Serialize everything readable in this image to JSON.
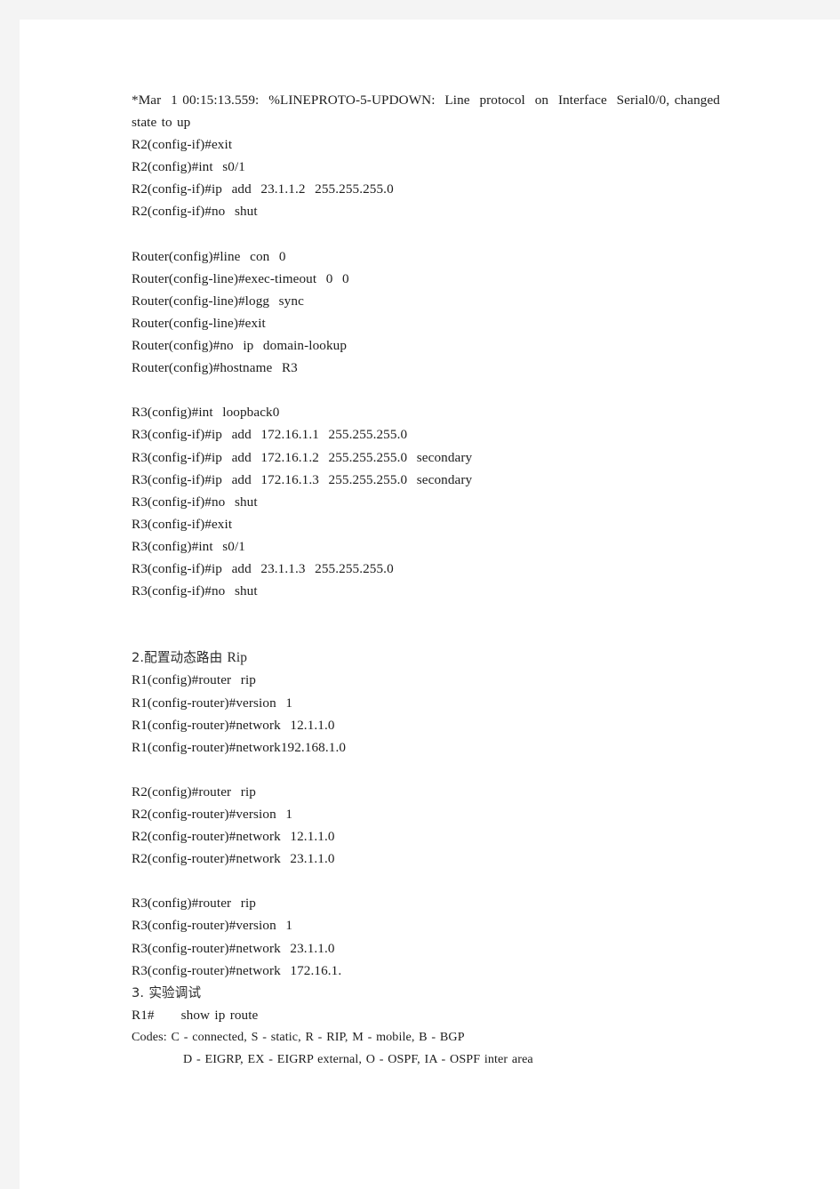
{
  "document": {
    "page_background": "#ffffff",
    "canvas_background": "#f4f4f4",
    "text_color": "#1c1c1c",
    "heading_color": "#2a2a2a",
    "blocks": [
      {
        "id": "log-block",
        "lines": [
          {
            "id": "log-line-1",
            "kind": "justified",
            "text": "*Mar  1 00:15:13.559:  %LINEPROTO-5-UPDOWN:  Line  protocol  on  Interface  Serial0/0, changed state to up"
          },
          {
            "id": "r2-exit",
            "kind": "plain",
            "text": "R2(config-if)#exit"
          },
          {
            "id": "r2-int-s01",
            "kind": "plain",
            "text": "R2(config)#int  s0/1"
          },
          {
            "id": "r2-ip-add",
            "kind": "plain",
            "text": "R2(config-if)#ip  add  23.1.1.2  255.255.255.0"
          },
          {
            "id": "r2-no-shut",
            "kind": "plain",
            "text": "R2(config-if)#no  shut"
          }
        ]
      },
      {
        "id": "router-console-block",
        "lines": [
          {
            "id": "rt-line-con",
            "kind": "plain",
            "text": "Router(config)#line  con  0"
          },
          {
            "id": "rt-exec-timeout",
            "kind": "plain",
            "text": "Router(config-line)#exec-timeout  0  0"
          },
          {
            "id": "rt-logg-sync",
            "kind": "plain",
            "text": "Router(config-line)#logg  sync"
          },
          {
            "id": "rt-exit",
            "kind": "plain",
            "text": "Router(config-line)#exit"
          },
          {
            "id": "rt-no-domain-lookup",
            "kind": "plain",
            "text": "Router(config)#no  ip  domain-lookup"
          },
          {
            "id": "rt-hostname-r3",
            "kind": "plain",
            "text": "Router(config)#hostname  R3"
          }
        ]
      },
      {
        "id": "r3-interface-block",
        "lines": [
          {
            "id": "r3-int-loopback0",
            "kind": "plain",
            "text": "R3(config)#int  loopback0"
          },
          {
            "id": "r3-ip-add-1",
            "kind": "plain",
            "text": "R3(config-if)#ip  add  172.16.1.1  255.255.255.0"
          },
          {
            "id": "r3-ip-add-2",
            "kind": "plain",
            "text": "R3(config-if)#ip  add  172.16.1.2  255.255.255.0  secondary"
          },
          {
            "id": "r3-ip-add-3",
            "kind": "plain",
            "text": "R3(config-if)#ip  add  172.16.1.3  255.255.255.0  secondary"
          },
          {
            "id": "r3-no-shut-1",
            "kind": "plain",
            "text": "R3(config-if)#no  shut"
          },
          {
            "id": "r3-exit",
            "kind": "plain",
            "text": "R3(config-if)#exit"
          },
          {
            "id": "r3-int-s01",
            "kind": "plain",
            "text": "R3(config)#int  s0/1"
          },
          {
            "id": "r3-ip-add-4",
            "kind": "plain",
            "text": "R3(config-if)#ip  add  23.1.1.3  255.255.255.0"
          },
          {
            "id": "r3-no-shut-2",
            "kind": "plain",
            "text": "R3(config-if)#no  shut"
          }
        ]
      },
      {
        "id": "rip-heading-block",
        "lines": [
          {
            "id": "heading-2",
            "kind": "cjk-heading",
            "text": "2.配置动态路由 Rip",
            "cjk": "2.配置动态路由 ",
            "latin": "Rip"
          },
          {
            "id": "r1-router-rip",
            "kind": "plain",
            "text": "R1(config)#router  rip"
          },
          {
            "id": "r1-version",
            "kind": "plain",
            "text": "R1(config-router)#version  1"
          },
          {
            "id": "r1-network-12",
            "kind": "plain",
            "text": "R1(config-router)#network  12.1.1.0"
          },
          {
            "id": "r1-network-192",
            "kind": "plain",
            "text": "R1(config-router)#network192.168.1.0"
          }
        ]
      },
      {
        "id": "r2-rip-block",
        "lines": [
          {
            "id": "r2-router-rip",
            "kind": "plain",
            "text": "R2(config)#router  rip"
          },
          {
            "id": "r2-version",
            "kind": "plain",
            "text": "R2(config-router)#version  1"
          },
          {
            "id": "r2-network-12",
            "kind": "plain",
            "text": "R2(config-router)#network  12.1.1.0"
          },
          {
            "id": "r2-network-23",
            "kind": "plain",
            "text": "R2(config-router)#network  23.1.1.0"
          }
        ]
      },
      {
        "id": "r3-rip-block",
        "lines": [
          {
            "id": "r3-router-rip",
            "kind": "plain",
            "text": "R3(config)#router  rip"
          },
          {
            "id": "r3-version",
            "kind": "plain",
            "text": "R3(config-router)#version  1"
          },
          {
            "id": "r3-network-23",
            "kind": "plain",
            "text": "R3(config-router)#network  23.1.1.0"
          },
          {
            "id": "r3-network-172",
            "kind": "plain",
            "text": "R3(config-router)#network  172.16.1."
          }
        ]
      },
      {
        "id": "debug-block",
        "lines": [
          {
            "id": "heading-3",
            "kind": "cjk-heading",
            "text": "3. 实验调试",
            "cjk": "3. 实验调试",
            "latin": ""
          },
          {
            "id": "r1-show-ip-route",
            "kind": "plain",
            "text": "R1#     show ip route"
          },
          {
            "id": "codes-line-1",
            "kind": "small",
            "text": "Codes: C - connected, S - static, R - RIP, M - mobile, B - BGP"
          },
          {
            "id": "codes-line-2",
            "kind": "small-indent",
            "text": "D - EIGRP, EX - EIGRP external, O - OSPF, IA - OSPF inter area"
          }
        ]
      }
    ]
  }
}
